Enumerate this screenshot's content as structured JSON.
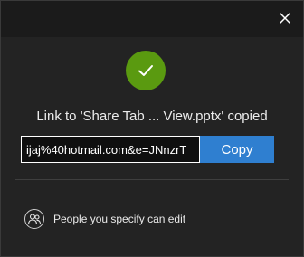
{
  "dialog": {
    "close_icon": "close-icon",
    "check_icon": "checkmark-icon",
    "message": "Link to 'Share Tab ... View.pptx' copied",
    "link_value": "ijaj%40hotmail.com&e=JNnzrT",
    "copy_label": "Copy",
    "permissions_icon": "people-icon",
    "permissions_label": "People you specify can edit"
  },
  "colors": {
    "background": "#232323",
    "success": "#5a9a10",
    "accent": "#2f7fd0"
  }
}
